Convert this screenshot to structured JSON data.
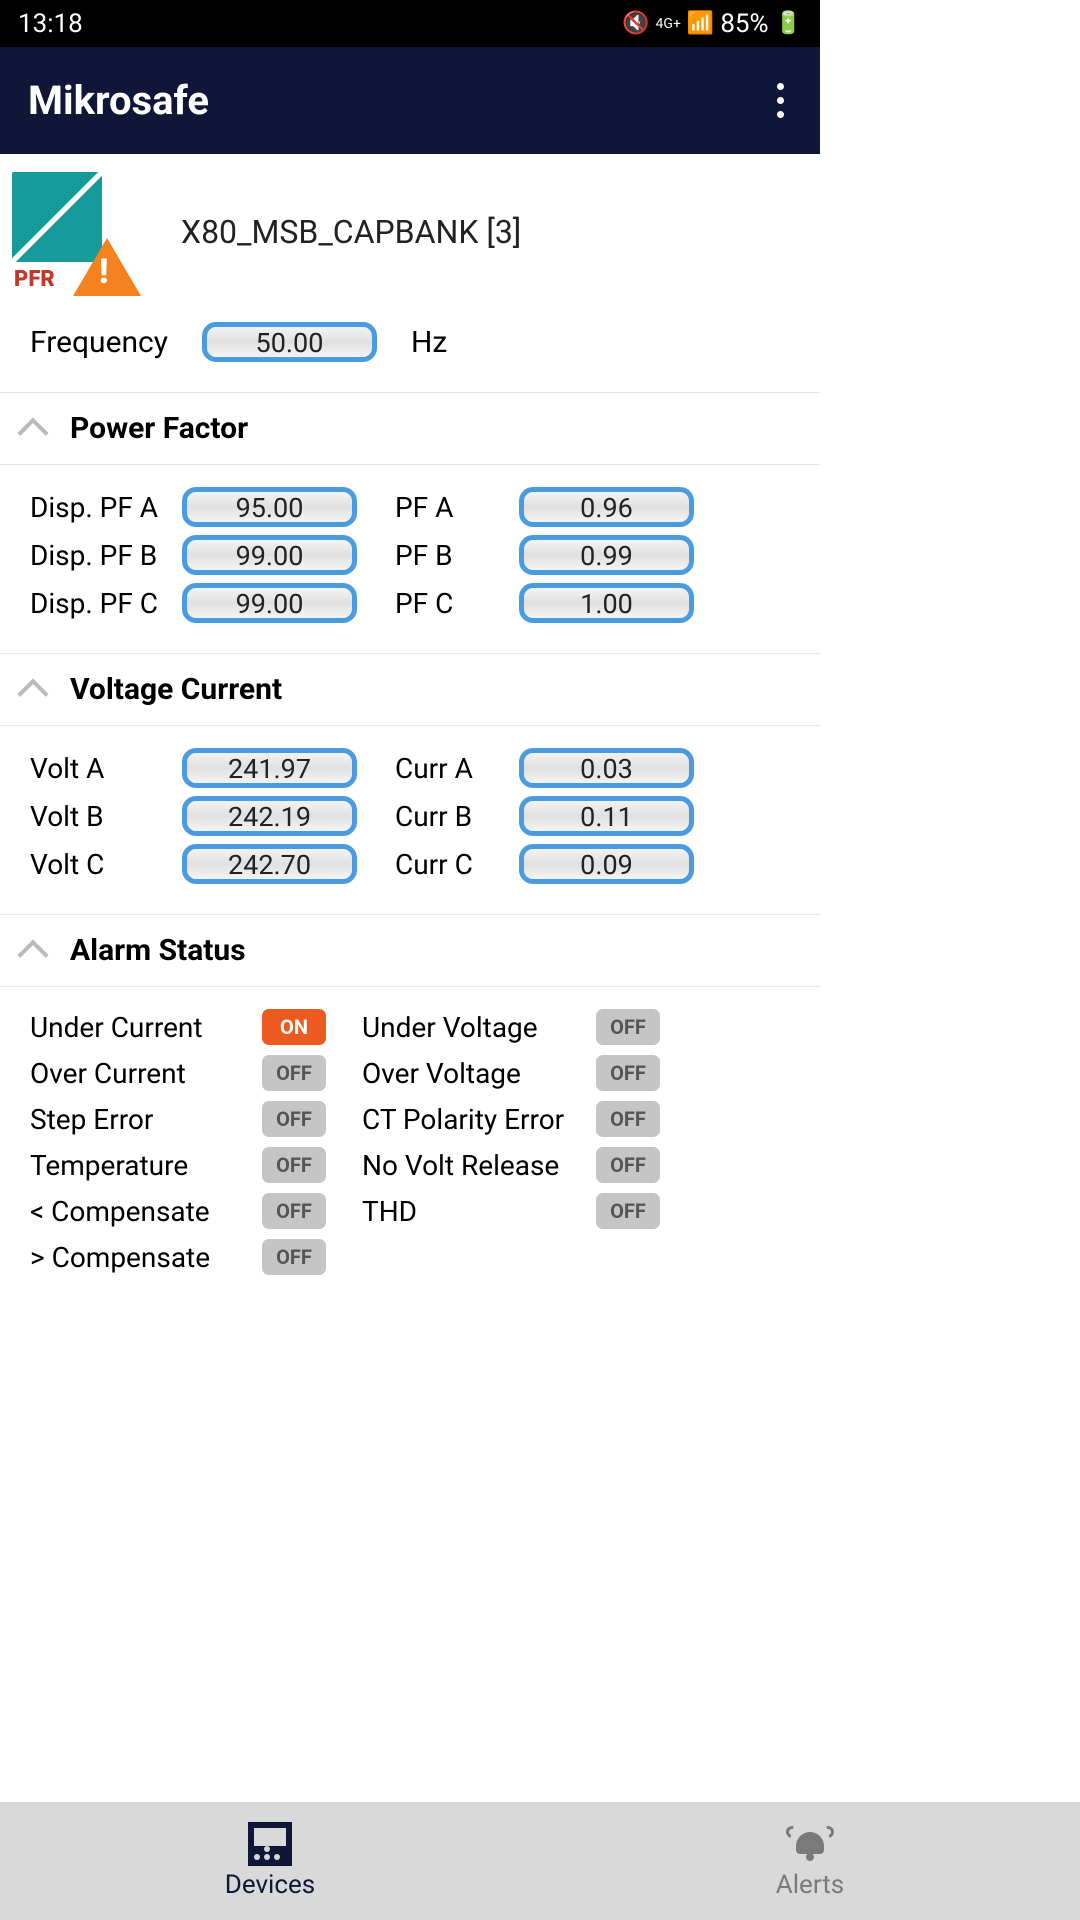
{
  "status": {
    "time": "13:18",
    "net": "4G+",
    "battery": "85%"
  },
  "app": {
    "title": "Mikrosafe"
  },
  "device": {
    "name": "X80_MSB_CAPBANK [3]",
    "icon_label": "PFR"
  },
  "frequency": {
    "label": "Frequency",
    "value": "50.00",
    "unit": "Hz"
  },
  "sections": {
    "power_factor": {
      "title": "Power Factor",
      "rows": [
        {
          "l1": "Disp. PF A",
          "v1": "95.00",
          "l2": "PF A",
          "v2": "0.96"
        },
        {
          "l1": "Disp. PF B",
          "v1": "99.00",
          "l2": "PF B",
          "v2": "0.99"
        },
        {
          "l1": "Disp. PF C",
          "v1": "99.00",
          "l2": "PF C",
          "v2": "1.00"
        }
      ]
    },
    "voltage_current": {
      "title": "Voltage Current",
      "rows": [
        {
          "l1": "Volt A",
          "v1": "241.97",
          "l2": "Curr A",
          "v2": "0.03"
        },
        {
          "l1": "Volt B",
          "v1": "242.19",
          "l2": "Curr B",
          "v2": "0.11"
        },
        {
          "l1": "Volt C",
          "v1": "242.70",
          "l2": "Curr C",
          "v2": "0.09"
        }
      ]
    },
    "alarm_status": {
      "title": "Alarm Status",
      "left": [
        {
          "label": "Under Current",
          "state": "ON"
        },
        {
          "label": "Over Current",
          "state": "OFF"
        },
        {
          "label": "Step Error",
          "state": "OFF"
        },
        {
          "label": "Temperature",
          "state": "OFF"
        },
        {
          "label": "< Compensate",
          "state": "OFF"
        },
        {
          "label": "> Compensate",
          "state": "OFF"
        }
      ],
      "right": [
        {
          "label": "Under Voltage",
          "state": "OFF"
        },
        {
          "label": "Over Voltage",
          "state": "OFF"
        },
        {
          "label": "CT Polarity Error",
          "state": "OFF"
        },
        {
          "label": "No Volt Release",
          "state": "OFF"
        },
        {
          "label": "THD",
          "state": "OFF"
        }
      ]
    }
  },
  "nav": {
    "devices": "Devices",
    "alerts": "Alerts"
  }
}
